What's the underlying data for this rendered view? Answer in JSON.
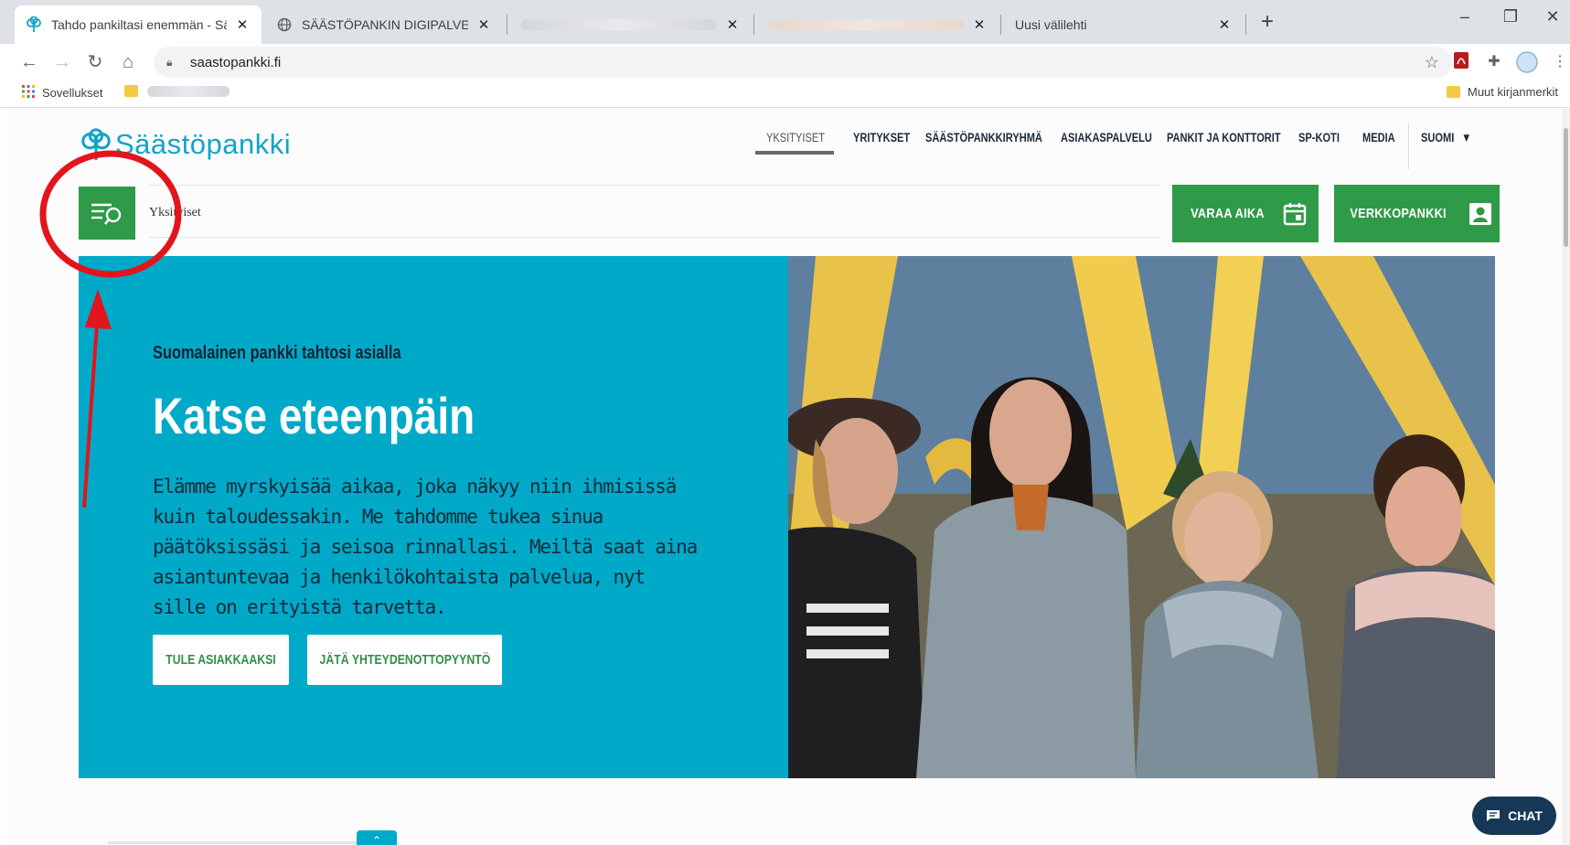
{
  "browser": {
    "tabs": [
      {
        "title": "Tahdo pankiltasi enemmän - Sää",
        "active": true,
        "icon": "saastopankki-favicon"
      },
      {
        "title": "SÄÄSTÖPANKIN DIGIPALVELUT",
        "active": false,
        "icon": "globe-icon"
      },
      {
        "title": "",
        "active": false,
        "icon": "blurred"
      },
      {
        "title": "",
        "active": false,
        "icon": "blurred"
      },
      {
        "title": "Uusi välilehti",
        "active": false,
        "icon": "none"
      }
    ],
    "new_tab": "+",
    "window": {
      "minimize": "–",
      "restore": "❐",
      "close": "✕"
    },
    "address": "saastopankki.fi",
    "bookmarks": {
      "apps_label": "Sovellukset",
      "other_label": "Muut kirjanmerkit"
    }
  },
  "site": {
    "logo_text": "Säästöpankki",
    "nav": [
      {
        "label": "YKSITYISET",
        "current": true
      },
      {
        "label": "YRITYKSET"
      },
      {
        "label": "SÄÄSTÖPANKKIRYHMÄ"
      },
      {
        "label": "ASIAKASPALVELU"
      },
      {
        "label": "PANKIT JA KONTTORIT"
      },
      {
        "label": "SP-KOTI"
      },
      {
        "label": "MEDIA"
      },
      {
        "label": "SUOMI"
      }
    ],
    "breadcrumb": "Yksityiset",
    "cta": {
      "book": "VARAA AIKA",
      "netbank": "VERKKOPANKKI"
    },
    "hero": {
      "eyebrow": "Suomalainen pankki tahtosi asialla",
      "headline": "Katse eteenpäin",
      "body": "Elämme myrskyisää aikaa, joka näkyy niin ihmisissä kuin taloudessakin. Me tahdomme tukea sinua päätöksissäsi ja seisoa rinnallasi. Meiltä saat aina asiantuntevaa ja henkilökohtaista palvelua, nyt sille on erityistä tarvetta.",
      "primary_button": "TULE ASIAKKAAKSI",
      "secondary_button": "JÄTÄ YHTEYDENOTTOPYYNTÖ"
    },
    "chat": "CHAT",
    "colors": {
      "brand_green": "#2f9a48",
      "brand_teal": "#00a9c8",
      "logo_blue": "#12a4c8",
      "annotation_red": "#e3141b"
    }
  }
}
